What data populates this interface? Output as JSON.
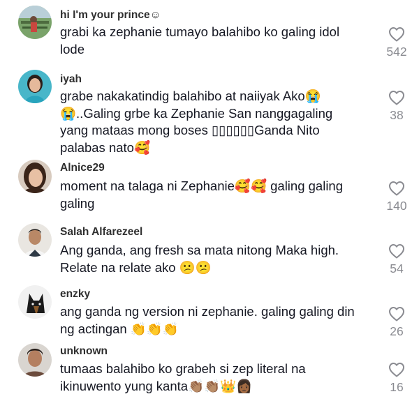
{
  "comments": [
    {
      "username": "hi I'm your prince☺",
      "text": "grabi ka zephanie tumayo balahibo ko galing idol\nlode",
      "likes": "542"
    },
    {
      "username": "iyah",
      "text": "grabe nakakatindig balahibo at naiiyak Ako😭\n😭..Galing grbe ka Zephanie San nanggagaling\nyang mataas mong boses ▯▯▯▯▯▯Ganda Nito\npalabas nato🥰",
      "likes": "38"
    },
    {
      "username": "Alnice29",
      "text": "moment na talaga ni Zephanie🥰🥰 galing galing\ngaling",
      "likes": "140"
    },
    {
      "username": "Salah Alfarezeel",
      "text": "Ang ganda, ang fresh sa mata nitong Maka high.\nRelate na relate ako 😕😕",
      "likes": "54"
    },
    {
      "username": "enzky",
      "text": "ang ganda ng version ni zephanie. galing galing din\nng actingan 👏👏👏",
      "likes": "26"
    },
    {
      "username": "unknown",
      "text": "tumaas balahibo ko grabeh si zep literal na\nikinuwento yung kanta👏🏽👏🏽👑👩🏾",
      "likes": "16"
    }
  ],
  "icons": {
    "like": "heart-outline-icon"
  },
  "colors": {
    "text": "#161823",
    "username": "#2f2f2f",
    "like_count": "#8a8b91",
    "background": "#ffffff"
  }
}
